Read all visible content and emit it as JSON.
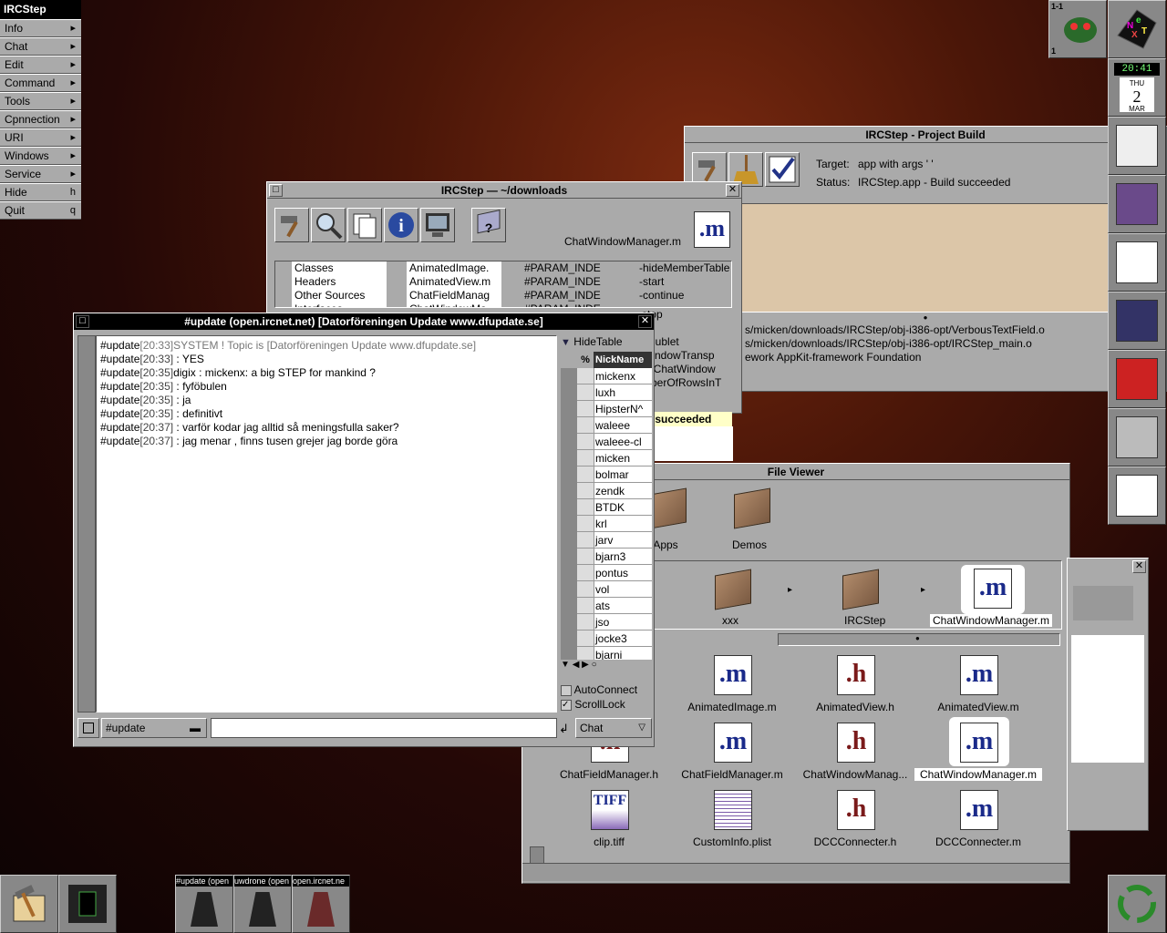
{
  "menu": {
    "title": "IRCStep",
    "items": [
      {
        "label": "Info",
        "key": "▸"
      },
      {
        "label": "Chat",
        "key": "▸"
      },
      {
        "label": "Edit",
        "key": "▸"
      },
      {
        "label": "Command",
        "key": "▸"
      },
      {
        "label": "Tools",
        "key": "▸"
      },
      {
        "label": "Cpnnection",
        "key": "▸"
      },
      {
        "label": "URI",
        "key": "▸"
      },
      {
        "label": "Windows",
        "key": "▸"
      },
      {
        "label": "Service",
        "key": "▸"
      },
      {
        "label": "Hide",
        "key": "h"
      },
      {
        "label": "Quit",
        "key": "q"
      }
    ]
  },
  "dock": {
    "workspace": "1-1",
    "workspace_num": "1",
    "clock": {
      "time": "20:41",
      "day": "THU",
      "date": "2",
      "month": "MAR"
    }
  },
  "build_window": {
    "title": "IRCStep - Project Build",
    "target_label": "Target:",
    "target_value": "app with args ' '",
    "status_label": "Status:",
    "status_value": "IRCStep.app - Build succeeded",
    "log": [
      "s/micken/downloads/IRCStep/obj-i386-opt/VerbousTextField.o",
      "s/micken/downloads/IRCStep/obj-i386-opt/IRCStep_main.o",
      "ework AppKit-framework Foundation"
    ]
  },
  "project_window": {
    "title": "IRCStep — ~/downloads",
    "file_label": "ChatWindowManager.m",
    "col1": [
      "Classes",
      "Headers",
      "Other Sources",
      "Interfaces"
    ],
    "col2": [
      "AnimatedImage.",
      "AnimatedView.m",
      "ChatFieldManag",
      "ChatWindowMa"
    ],
    "col3": [
      "#PARAM_INDE",
      "#PARAM_INDE",
      "#PARAM_INDE",
      "#PARAM_INDE"
    ],
    "col4": [
      "-hideMemberTable",
      "-start",
      "-continue",
      "-stop",
      "-p",
      "-pSublet",
      "-WindowTransp",
      "-seChatWindow",
      "-mberOfRowsInT"
    ],
    "build_status": "ild succeeded"
  },
  "chat_window": {
    "title": "#update (open.ircnet.net) [Datorföreningen Update www.dfupdate.se]",
    "lines": [
      {
        "chan": "#update",
        "time": "[20:33]",
        "text": "SYSTEM ! Topic is [Datorföreningen Update www.dfupdate.se]",
        "system": true
      },
      {
        "chan": "#update",
        "time": "[20:33]",
        "text": " : YES"
      },
      {
        "chan": "#update",
        "time": "[20:35]",
        "text": "digix : mickenx: a big STEP for mankind ?"
      },
      {
        "chan": "#update",
        "time": "[20:35]",
        "text": " : fyföbulen"
      },
      {
        "chan": "#update",
        "time": "[20:35]",
        "text": " : ja"
      },
      {
        "chan": "#update",
        "time": "[20:35]",
        "text": " : definitivt"
      },
      {
        "chan": "#update",
        "time": "[20:37]",
        "text": " : varför kodar jag alltid så meningsfulla saker?"
      },
      {
        "chan": "#update",
        "time": "[20:37]",
        "text": " : jag menar , finns tusen grejer jag borde göra"
      }
    ],
    "hide_table": "HideTable",
    "col_pct": "%",
    "col_nick": "NickName",
    "nicks": [
      "mickenx",
      "luxh",
      "HipsterN^",
      "waleee",
      "waleee-cl",
      "micken",
      "bolmar",
      "zendk",
      "BTDK",
      "krl",
      "jarv",
      "bjarn3",
      "pontus",
      "vol",
      "ats",
      "jso",
      "jocke3",
      "bjarni"
    ],
    "auto_connect": "AutoConnect",
    "scroll_lock": "ScrollLock",
    "channel_select": "#update",
    "mode_select": "Chat",
    "input_value": ""
  },
  "file_viewer": {
    "title": "File Viewer",
    "top_icons": [
      {
        "label": "tApps"
      },
      {
        "label": "Demos"
      }
    ],
    "path": [
      {
        "label": "xxx"
      },
      {
        "label": "IRCStep"
      },
      {
        "label": "ChatWindowManager.m"
      }
    ],
    "files": [
      {
        "label": "AnimatedImage.m",
        "ext": ".m"
      },
      {
        "label": "AnimatedView.h",
        "ext": ".h"
      },
      {
        "label": "AnimatedView.m",
        "ext": ".m"
      },
      {
        "label": "ChatFieldManager.h",
        "ext": ".h"
      },
      {
        "label": "ChatFieldManager.m",
        "ext": ".m"
      },
      {
        "label": "ChatWindowManag...",
        "ext": ".h"
      },
      {
        "label": "ChatWindowManager.m",
        "ext": ".m"
      },
      {
        "label": "clip.tiff",
        "ext": "TIFF"
      },
      {
        "label": "CustomInfo.plist",
        "ext": ""
      },
      {
        "label": "DCCConnecter.h",
        "ext": ".h"
      },
      {
        "label": "DCCConnecter.m",
        "ext": ".m"
      }
    ]
  },
  "taskbar": [
    {
      "label": "#update (open"
    },
    {
      "label": "uwdrone (open"
    },
    {
      "label": "open.ircnet.ne"
    }
  ],
  "dock_icons": [
    "mail-icon",
    "books-icon",
    "textedit-icon",
    "omniweb-icon",
    "pdf-icon",
    "terminal-icon",
    "word-icon"
  ],
  "close_glyph": "✕",
  "mini_glyph": "□"
}
